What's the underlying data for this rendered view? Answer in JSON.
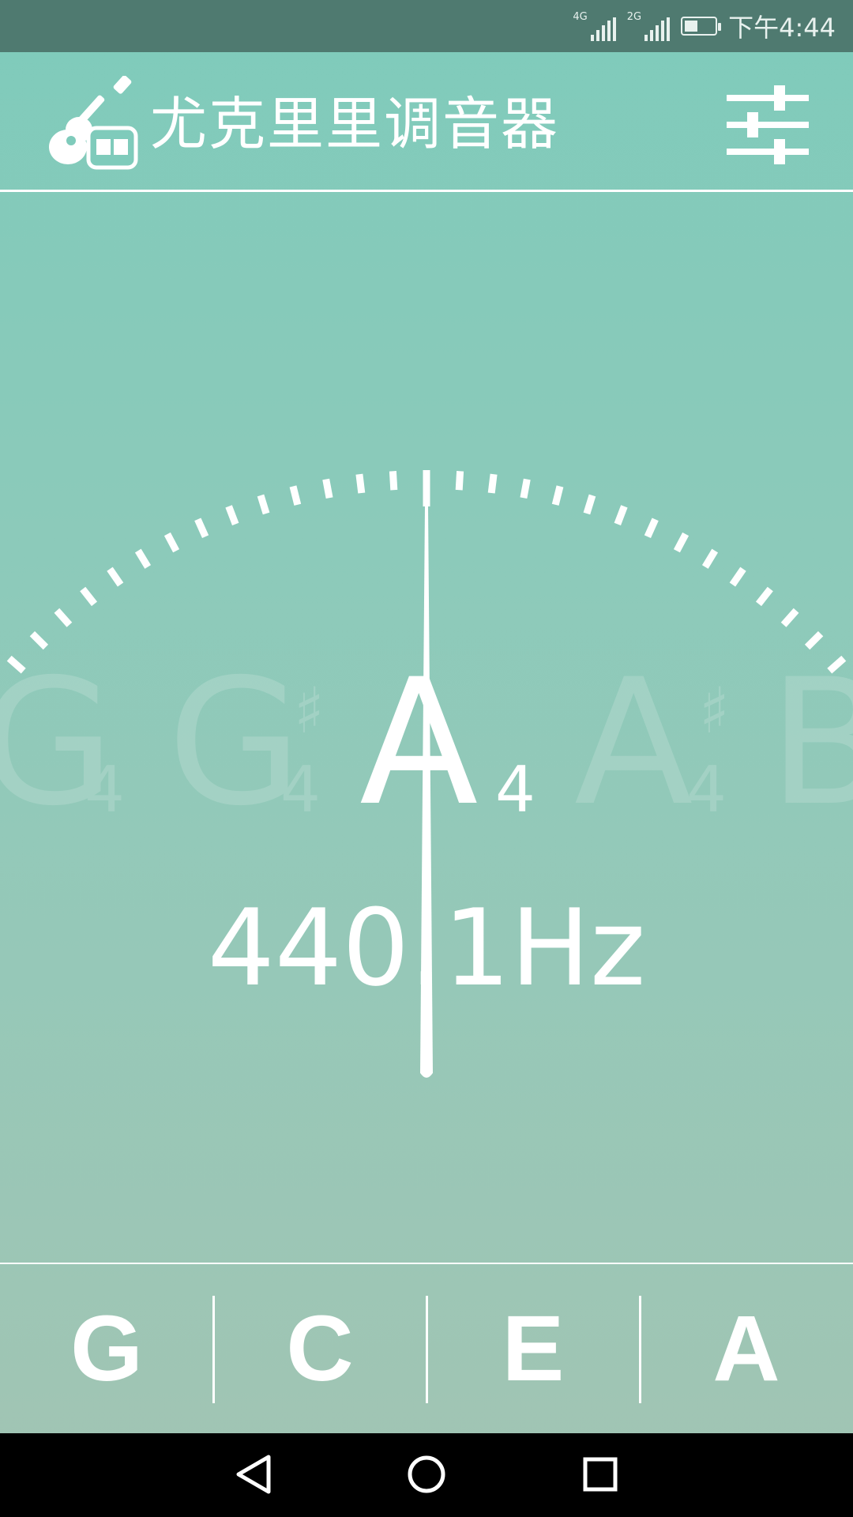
{
  "status_bar": {
    "network_1": "4G",
    "network_2": "2G",
    "battery_level": 0.45,
    "time": "下午4:44"
  },
  "header": {
    "title": "尤克里里调音器",
    "icon": "ukulele-tuner-icon",
    "settings_icon": "sliders-icon"
  },
  "tuner": {
    "notes": [
      {
        "letter": "G",
        "octave": "4",
        "sharp": "",
        "active": false
      },
      {
        "letter": "G",
        "octave": "4",
        "sharp": "♯",
        "active": false
      },
      {
        "letter": "A",
        "octave": "4",
        "sharp": "",
        "active": true
      },
      {
        "letter": "A",
        "octave": "4",
        "sharp": "♯",
        "active": false
      },
      {
        "letter": "B",
        "octave": "",
        "sharp": "",
        "active": false
      }
    ],
    "current_note": "A",
    "current_octave": "4",
    "frequency": "440.1Hz",
    "needle_deviation": 0
  },
  "strings": {
    "items": [
      "G",
      "C",
      "E",
      "A"
    ]
  },
  "nav_bar": {
    "back_icon": "back-triangle-icon",
    "home_icon": "home-circle-icon",
    "recents_icon": "recents-square-icon"
  },
  "colors": {
    "status_bar": "#4f7a70",
    "accent": "#7fcbbb",
    "text": "#ffffff"
  }
}
